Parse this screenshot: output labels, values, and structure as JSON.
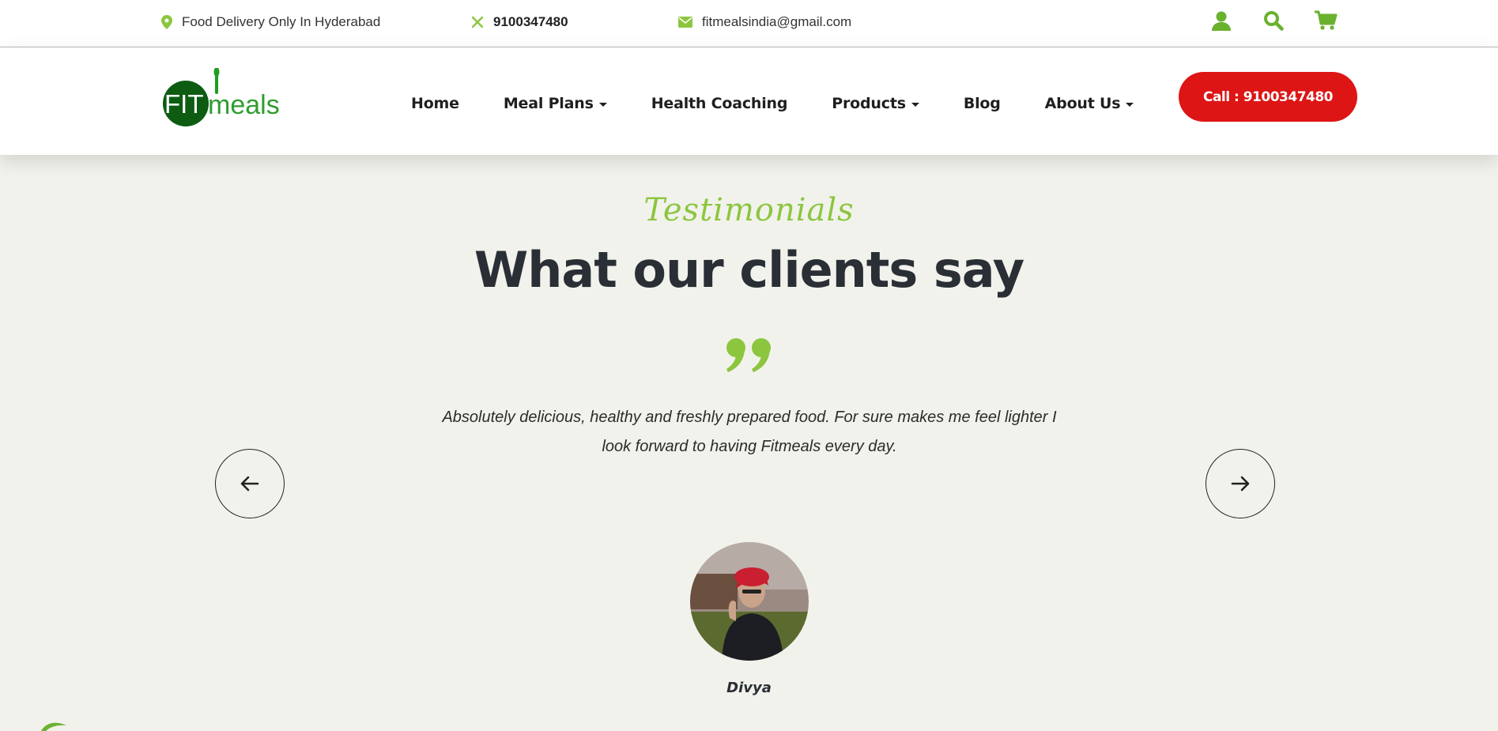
{
  "topbar": {
    "location": "Food Delivery Only In Hyderabad",
    "phone": "9100347480",
    "email": "fitmealsindia@gmail.com",
    "icons": [
      "user-icon",
      "search-icon",
      "cart-icon"
    ]
  },
  "brand": {
    "logo_text": "FITmeals"
  },
  "nav": {
    "items": [
      {
        "label": "Home",
        "dropdown": false
      },
      {
        "label": "Meal Plans",
        "dropdown": true
      },
      {
        "label": "Health Coaching",
        "dropdown": false
      },
      {
        "label": "Products",
        "dropdown": true
      },
      {
        "label": "Blog",
        "dropdown": false
      },
      {
        "label": "About Us",
        "dropdown": true
      }
    ],
    "call_button": "Call : 9100347480"
  },
  "testimonials": {
    "eyebrow": "Testimonials",
    "title": "What our clients say",
    "quote": "Absolutely delicious, healthy and freshly prepared food. For sure makes me feel lighter I look forward to having Fitmeals every day.",
    "client_name": "Divya",
    "prev_icon": "arrow-left-icon",
    "next_icon": "arrow-right-icon"
  },
  "colors": {
    "accent_green": "#8cc63f",
    "logo_green": "#1e7d1e",
    "call_red": "#dd1515",
    "page_bg": "#f2f2ec"
  }
}
